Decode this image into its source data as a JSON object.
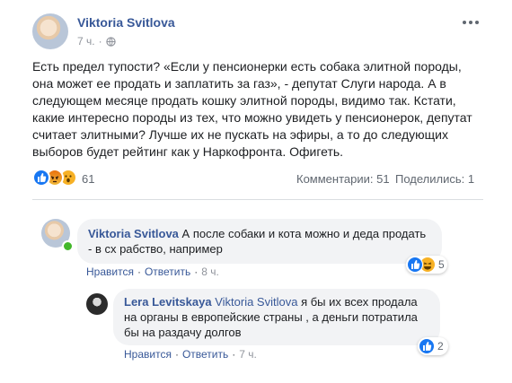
{
  "post": {
    "author": "Viktoria Svitlova",
    "time": "7 ч.",
    "audience_icon": "globe-icon",
    "text": "Есть предел тупости? «Если у пенсионерки есть собака элитной породы, она может ее продать и заплатить за газ», - депутат Слуги народа. А в следующем месяце продать кошку элитной породы, видимо так. Кстати, какие интересно породы из тех, что можно увидеть у пенсионерок, депутат считает элитными? Лучше их не пускать на эфиры, а то до следующих выборов будет рейтинг как у Наркофронта. Офигеть.",
    "reactions_count": "61",
    "comments_label": "Комментарии: 51",
    "shares_label": "Поделились: 1",
    "more_icon": "more-dots-icon"
  },
  "comments": [
    {
      "author": "Viktoria Svitlova",
      "text": "А после собаки и кота можно и деда продать - в сх рабство, например",
      "like_label": "Нравится",
      "reply_label": "Ответить",
      "time": "8 ч.",
      "reaction_count": "5"
    }
  ],
  "reply": {
    "author": "Lera Levitskaya",
    "mention": "Viktoria Svitlova",
    "text": "я бы их всех продала на органы в европейские страны , а деньги потратила бы на раздачу долгов",
    "like_label": "Нравится",
    "reply_label": "Ответить",
    "time": "7 ч.",
    "reaction_count": "2"
  },
  "separator": "·",
  "colors": {
    "link": "#385898",
    "like": "#1877f2",
    "bubble": "#f2f3f5",
    "meta": "#90949c"
  }
}
